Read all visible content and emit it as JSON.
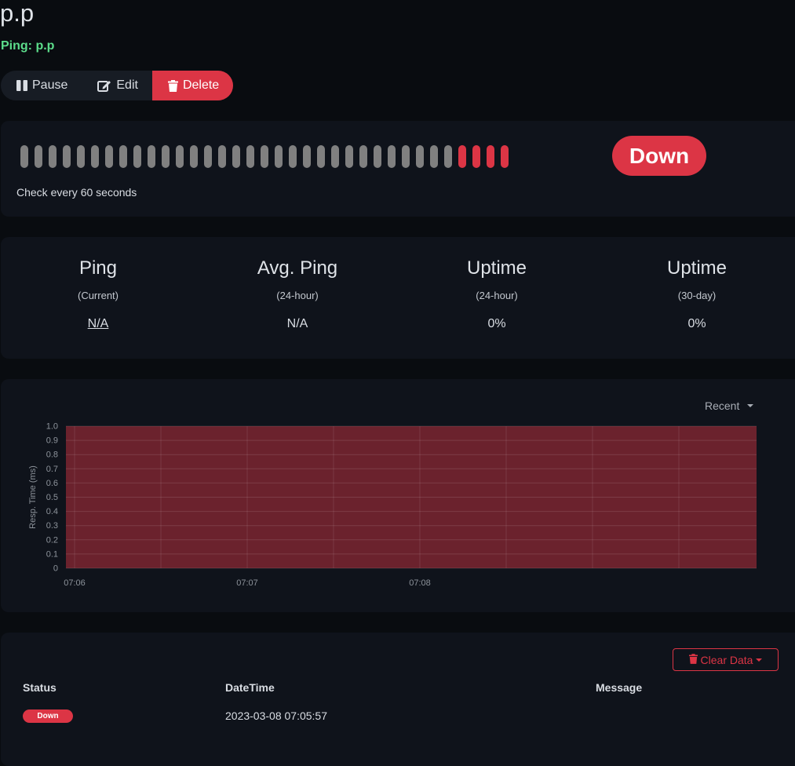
{
  "monitor": {
    "name": "p.p",
    "subtitle": "Ping: p.p"
  },
  "actions": {
    "pause_label": "Pause",
    "edit_label": "Edit",
    "delete_label": "Delete"
  },
  "heartbeat": {
    "beats": [
      "up",
      "up",
      "up",
      "up",
      "up",
      "up",
      "up",
      "up",
      "up",
      "up",
      "up",
      "up",
      "up",
      "up",
      "up",
      "up",
      "up",
      "up",
      "up",
      "up",
      "up",
      "up",
      "up",
      "up",
      "up",
      "up",
      "up",
      "up",
      "up",
      "up",
      "up",
      "down",
      "down",
      "down",
      "down"
    ],
    "status": "Down",
    "interval_text": "Check every 60 seconds",
    "colors": {
      "unknown": "#808080",
      "down": "#dc3545"
    }
  },
  "stats": [
    {
      "label": "Ping",
      "sub": "(Current)",
      "value": "N/A"
    },
    {
      "label": "Avg. Ping",
      "sub": "(24-hour)",
      "value": "N/A"
    },
    {
      "label": "Uptime",
      "sub": "(24-hour)",
      "value": "0%"
    },
    {
      "label": "Uptime",
      "sub": "(30-day)",
      "value": "0%"
    }
  ],
  "chart": {
    "period_label": "Recent"
  },
  "chart_data": {
    "type": "area",
    "ylabel": "Resp. Time (ms)",
    "ylim": [
      0,
      1.0
    ],
    "yticks": [
      "0",
      "0.1",
      "0.2",
      "0.3",
      "0.4",
      "0.5",
      "0.6",
      "0.7",
      "0.8",
      "0.9",
      "1.0"
    ],
    "xticks": [
      "07:06",
      "07:07",
      "07:08"
    ],
    "down_regions": [
      {
        "from": "07:05:57",
        "to": "07:09:57"
      }
    ],
    "down_color": "#dc3545",
    "grid": true
  },
  "events": {
    "clear_label": "Clear Data",
    "columns": [
      "Status",
      "DateTime",
      "Message"
    ],
    "rows": [
      {
        "status": "Down",
        "datetime": "2023-03-08 07:05:57",
        "message": ""
      }
    ]
  }
}
